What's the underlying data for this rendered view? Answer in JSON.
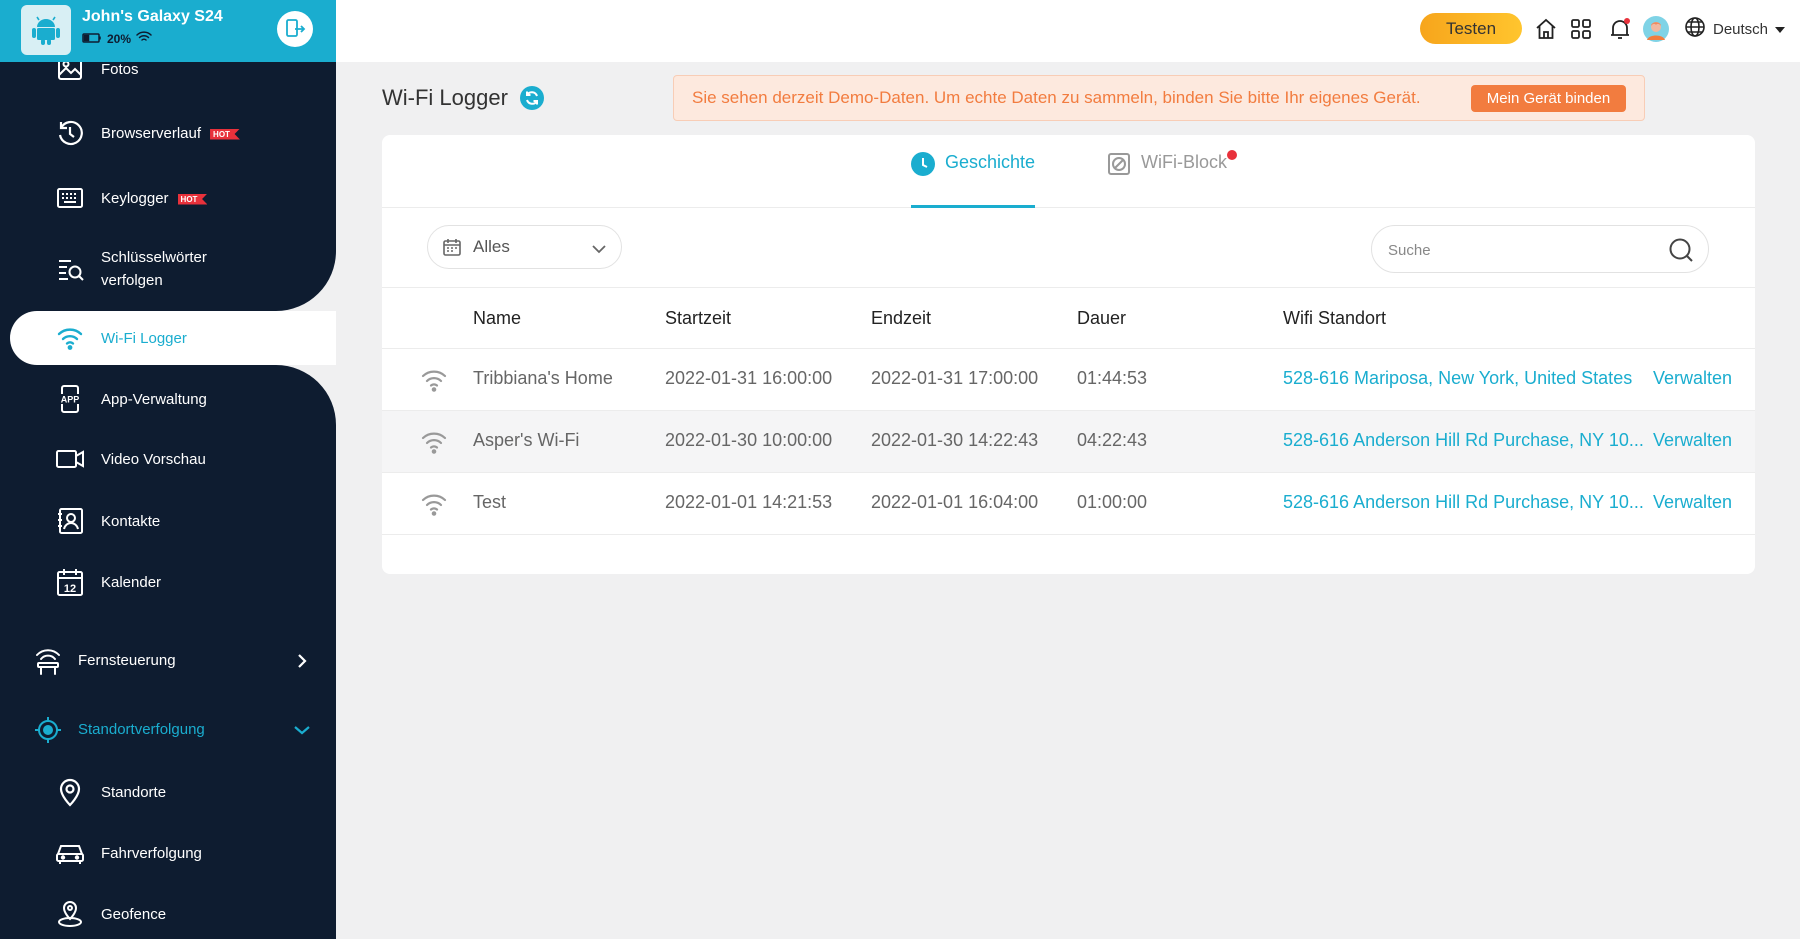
{
  "device": {
    "name": "John's Galaxy S24",
    "battery": "20%"
  },
  "sidebar": {
    "items": [
      {
        "label": "Fotos",
        "icon": "photo-icon"
      },
      {
        "label": "Browserverlauf",
        "icon": "history-icon",
        "badge": "HOT"
      },
      {
        "label": "Keylogger",
        "icon": "keyboard-icon",
        "badge": "HOT"
      },
      {
        "label_line1": "Schlüsselwörter",
        "label_line2": "verfolgen",
        "icon": "keyword-search-icon"
      },
      {
        "label": "Wi-Fi Logger",
        "icon": "wifi-icon",
        "active": true
      },
      {
        "label": "App-Verwaltung",
        "icon": "app-icon",
        "app_text": "APP"
      },
      {
        "label": "Video Vorschau",
        "icon": "video-icon"
      },
      {
        "label": "Kontakte",
        "icon": "contacts-icon"
      },
      {
        "label": "Kalender",
        "icon": "calendar-icon",
        "cal_number": "12"
      }
    ],
    "groups": [
      {
        "label": "Fernsteuerung",
        "icon": "remote-control-icon",
        "expanded": false
      },
      {
        "label": "Standortverfolgung",
        "icon": "location-target-icon",
        "expanded": true
      }
    ],
    "sub_items": [
      {
        "label": "Standorte",
        "icon": "map-pin-icon"
      },
      {
        "label": "Fahrverfolgung",
        "icon": "car-icon"
      },
      {
        "label": "Geofence",
        "icon": "geofence-icon"
      }
    ]
  },
  "topbar": {
    "test_button": "Testen",
    "language": "Deutsch"
  },
  "page": {
    "title": "Wi-Fi Logger",
    "banner_text": "Sie sehen derzeit Demo-Daten. Um echte Daten zu sammeln, binden Sie bitte Ihr eigenes Gerät.",
    "bind_button": "Mein Gerät binden"
  },
  "tabs": [
    {
      "label": "Geschichte",
      "active": true
    },
    {
      "label": "WiFi-Block",
      "active": false,
      "notification_dot": true
    }
  ],
  "filter": {
    "selected": "Alles"
  },
  "search": {
    "placeholder": "Suche",
    "value": ""
  },
  "table": {
    "columns": [
      "Name",
      "Startzeit",
      "Endzeit",
      "Dauer",
      "Wifi Standort"
    ],
    "rows": [
      {
        "name": "Tribbiana's Home",
        "start": "2022-01-31 16:00:00",
        "end": "2022-01-31 17:00:00",
        "duration": "01:44:53",
        "location": "528-616 Mariposa, New York, United States",
        "action": "Verwalten"
      },
      {
        "name": "Asper's Wi-Fi",
        "start": "2022-01-30 10:00:00",
        "end": "2022-01-30 14:22:43",
        "duration": "04:22:43",
        "location": "528-616 Anderson Hill Rd Purchase, NY 10...",
        "action": "Verwalten"
      },
      {
        "name": "Test",
        "start": "2022-01-01 14:21:53",
        "end": "2022-01-01 16:04:00",
        "duration": "01:00:00",
        "location": "528-616 Anderson Hill Rd Purchase, NY 10...",
        "action": "Verwalten"
      }
    ]
  },
  "colors": {
    "accent": "#1aadcf",
    "sidebar": "#0e1c30",
    "warning": "#f27c3f",
    "test_button": "#ffb627",
    "hot": "#e8313b"
  }
}
